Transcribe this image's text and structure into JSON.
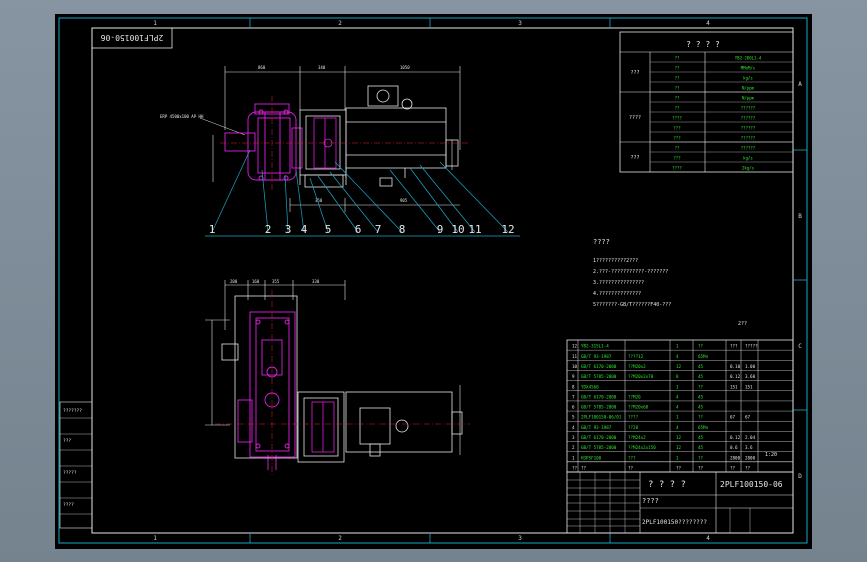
{
  "drawing": {
    "number": "2PLF100150-06",
    "number_mirrored": "2PLF100150-06",
    "title_cn": "? ? ? ?",
    "title_sub": "2PLF100150????????",
    "misc_label": "????",
    "misc_small": "2??"
  },
  "border": {
    "col_marks_top": [
      "1",
      "2",
      "3",
      "4"
    ],
    "col_marks_bottom": [
      "1",
      "2",
      "3",
      "4"
    ],
    "row_marks_right": [
      "A",
      "B",
      "C",
      "D"
    ]
  },
  "callouts": [
    "1",
    "2",
    "3",
    "4",
    "5",
    "6",
    "7",
    "8",
    "9",
    "10",
    "11",
    "12"
  ],
  "tech_table": {
    "title": "? ? ? ?",
    "groups": [
      "???",
      "????",
      "???"
    ],
    "rows": [
      [
        "??",
        "YB2-200L1-4"
      ],
      [
        "??",
        "MMoM/s"
      ],
      [
        "??",
        "kg/s"
      ],
      [
        "??",
        "N/ppm"
      ],
      [
        "??",
        "N/ppm"
      ],
      [
        "??",
        "??????"
      ],
      [
        "????",
        "??????"
      ],
      [
        "???",
        "??????"
      ],
      [
        "???",
        "??????"
      ],
      [
        "??",
        "??????"
      ],
      [
        "???",
        "kg/s"
      ],
      [
        "????",
        "2kg/s"
      ]
    ]
  },
  "notes": {
    "heading": "????",
    "lines": [
      "1??????????2???",
      "2.???-???????????-???????",
      "3.???????????????",
      "4.??????????????",
      "5???????-GB/T??????F40-???"
    ]
  },
  "bom": {
    "rows": [
      [
        "12",
        "YB2-315L1-4",
        "",
        "1",
        "??",
        "???",
        "?????"
      ],
      [
        "11",
        "GB/T 93-1987",
        "????12",
        "4",
        "65Mn",
        "",
        ""
      ],
      [
        "10",
        "GB/T 6170-2000",
        "??M20x2",
        "12",
        "45",
        "0.10",
        "1.00"
      ],
      [
        "9",
        "GB/T 5785-2000",
        "??M20x2x70",
        "8",
        "45",
        "0.12",
        "3.60"
      ],
      [
        "8",
        "YDX4560",
        "",
        "1",
        "??",
        "151",
        "151"
      ],
      [
        "7",
        "GB/T 6170-2000",
        "??M20",
        "4",
        "45",
        "",
        ""
      ],
      [
        "6",
        "GB/T 5785-2000",
        "??M20x60",
        "4",
        "45",
        "",
        ""
      ],
      [
        "5",
        "2PLF100150-06/01",
        "????",
        "1",
        "??",
        "67",
        "67"
      ],
      [
        "4",
        "GB/T 93-1987",
        "??20",
        "4",
        "65Mn",
        "",
        ""
      ],
      [
        "3",
        "GB/T 6170-2000",
        "??M24x2",
        "12",
        "45",
        "0.12",
        "2.04"
      ],
      [
        "2",
        "GB/T 5785-2000",
        "??M24x2x150",
        "12",
        "45",
        "0.6",
        "3.6"
      ],
      [
        "1",
        "H3PSF100",
        "???",
        "1",
        "??",
        "2800",
        "2800"
      ]
    ],
    "header": [
      "??",
      "??",
      "??",
      "??",
      "??",
      "??",
      "??"
    ],
    "scale": "1:20"
  },
  "side_labels": [
    "???????",
    "???",
    "?????",
    "????"
  ]
}
